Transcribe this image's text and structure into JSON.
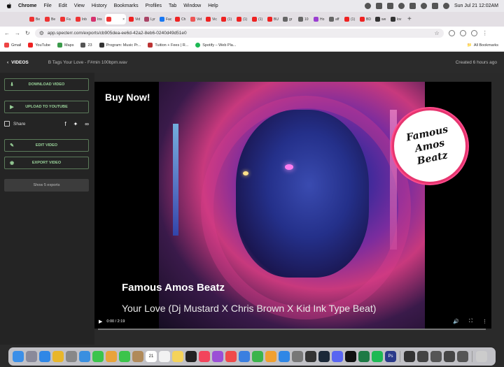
{
  "menubar": {
    "app": "Chrome",
    "items": [
      "File",
      "Edit",
      "View",
      "History",
      "Bookmarks",
      "Profiles",
      "Tab",
      "Window",
      "Help"
    ],
    "datetime": "Sun Jul 21  12:02AM"
  },
  "tabs": [
    {
      "label": "Be",
      "color": "#e33"
    },
    {
      "label": "Be",
      "color": "#e33"
    },
    {
      "label": "Fa",
      "color": "#e33"
    },
    {
      "label": "Inb",
      "color": "#e33"
    },
    {
      "label": "Ins",
      "color": "#d6316e"
    },
    {
      "label": "",
      "color": "#e33",
      "active": true
    },
    {
      "label": "Vid",
      "color": "#e22"
    },
    {
      "label": "Lyr",
      "color": "#a46"
    },
    {
      "label": "Fac",
      "color": "#1877f2"
    },
    {
      "label": "Ch",
      "color": "#e22"
    },
    {
      "label": "Vid",
      "color": "#e55"
    },
    {
      "label": "Vic",
      "color": "#e22"
    },
    {
      "label": "(1)",
      "color": "#e22"
    },
    {
      "label": "(1)",
      "color": "#e22"
    },
    {
      "label": "(1)",
      "color": "#e22"
    },
    {
      "label": "BU",
      "color": "#e22"
    },
    {
      "label": "gr",
      "color": "#666"
    },
    {
      "label": "10",
      "color": "#666"
    },
    {
      "label": "Ho",
      "color": "#9b3fd1"
    },
    {
      "label": "aff",
      "color": "#666"
    },
    {
      "label": "(1)",
      "color": "#e22"
    },
    {
      "label": "BD",
      "color": "#e22"
    },
    {
      "label": "we",
      "color": "#333"
    },
    {
      "label": "lov",
      "color": "#333"
    }
  ],
  "address": {
    "url": "app.specterr.com/exports/cb905dea-ee6d-42a2-8eb6-0240d49d51e0"
  },
  "bookmarks": {
    "items": [
      {
        "label": "Gmail",
        "color": "#e44"
      },
      {
        "label": "YouTube",
        "color": "#e22"
      },
      {
        "label": "Maps",
        "color": "#3a9a4a"
      },
      {
        "label": "23",
        "color": "#555"
      },
      {
        "label": "Program: Music Pr...",
        "color": "#333"
      },
      {
        "label": "Tuition + Fees | R...",
        "color": "#b33"
      },
      {
        "label": "Spotify – Web Pla...",
        "color": "#1db954"
      }
    ],
    "all": "All Bookmarks"
  },
  "app_header": {
    "back_label": "VIDEOS",
    "filename": "B Tags Your Love - F#min 100bpm.wav",
    "created": "Created 6 hours ago"
  },
  "sidebar": {
    "download": "DOWNLOAD VIDEO",
    "upload": "UPLOAD TO YOUTUBE",
    "share": "Share",
    "edit": "EDIT VIDEO",
    "export": "EXPORT VIDEO",
    "show_exports": "Show 5 exports"
  },
  "video": {
    "buy_now": "Buy Now!",
    "badge": "Famous Amos Beatz",
    "title": "Famous Amos Beatz",
    "subtitle": "Your Love (Dj Mustard X Chris Brown X Kid Ink Type Beat)",
    "time": "0:00 / 2:19",
    "progress": 0
  },
  "dock": {
    "icons": [
      {
        "name": "finder",
        "color": "#3b8fe8"
      },
      {
        "name": "launchpad",
        "color": "#8a8a9a"
      },
      {
        "name": "safari",
        "color": "#2f87e6"
      },
      {
        "name": "chrome",
        "color": "#e8b62a"
      },
      {
        "name": "settings",
        "color": "#888"
      },
      {
        "name": "mail",
        "color": "#3a8fe0"
      },
      {
        "name": "messages",
        "color": "#3bc44b"
      },
      {
        "name": "photos",
        "color": "#e9a33a"
      },
      {
        "name": "facetime",
        "color": "#3bc44b"
      },
      {
        "name": "contacts",
        "color": "#b08a5a"
      },
      {
        "name": "calendar",
        "color": "#fff",
        "text": "21"
      },
      {
        "name": "reminders",
        "color": "#f2f2f2"
      },
      {
        "name": "notes",
        "color": "#f5d35a"
      },
      {
        "name": "tv",
        "color": "#222"
      },
      {
        "name": "music",
        "color": "#f2445c"
      },
      {
        "name": "podcasts",
        "color": "#9b4fd6"
      },
      {
        "name": "news",
        "color": "#f04a4a"
      },
      {
        "name": "keynote",
        "color": "#3a7fe0"
      },
      {
        "name": "numbers",
        "color": "#3bb44b"
      },
      {
        "name": "pages",
        "color": "#f0a030"
      },
      {
        "name": "app-store",
        "color": "#2f87e6"
      },
      {
        "name": "preferences",
        "color": "#777"
      },
      {
        "name": "logic",
        "color": "#333"
      },
      {
        "name": "steam",
        "color": "#1b2838"
      },
      {
        "name": "discord",
        "color": "#5865f2"
      },
      {
        "name": "capcut",
        "color": "#111"
      },
      {
        "name": "excel",
        "color": "#1d7a45"
      },
      {
        "name": "spotify",
        "color": "#1db954"
      },
      {
        "name": "photoshop",
        "color": "#2a3a8a",
        "text": "Ps"
      },
      {
        "name": "utility",
        "color": "#333"
      },
      {
        "name": "window-1",
        "color": "#444"
      },
      {
        "name": "window-2",
        "color": "#555"
      },
      {
        "name": "window-3",
        "color": "#444"
      },
      {
        "name": "window-4",
        "color": "#555"
      },
      {
        "name": "trash",
        "color": "#ccc"
      }
    ]
  }
}
